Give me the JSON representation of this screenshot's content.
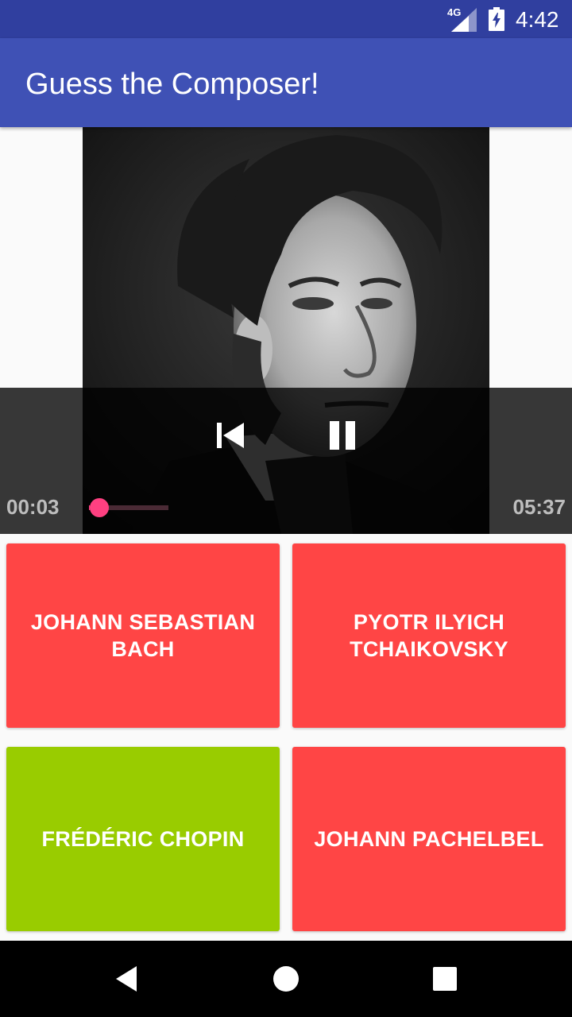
{
  "status_bar": {
    "network": "4G",
    "time": "4:42"
  },
  "app_bar": {
    "title": "Guess the Composer!"
  },
  "portrait": {
    "icon": "composer-portrait-image"
  },
  "media_controller": {
    "current_time": "00:03",
    "total_time": "05:37",
    "progress_fraction": 0.01,
    "accent": "#ff4081",
    "prev_icon": "skip-previous-icon",
    "pause_icon": "pause-icon"
  },
  "answers": [
    {
      "label": "JOHANN SEBASTIAN BACH",
      "state": "wrong",
      "color": "#ff4545"
    },
    {
      "label": "PYOTR ILYICH TCHAIKOVSKY",
      "state": "wrong",
      "color": "#ff4545"
    },
    {
      "label": "FRÉDÉRIC CHOPIN",
      "state": "correct",
      "color": "#99cc00"
    },
    {
      "label": "JOHANN PACHELBEL",
      "state": "wrong",
      "color": "#ff4545"
    }
  ],
  "colors": {
    "status_bar": "#303f9f",
    "app_bar": "#3f51b5",
    "wrong": "#ff4545",
    "correct": "#99cc00"
  },
  "nav_bar": {
    "back_icon": "back-triangle-icon",
    "home_icon": "home-circle-icon",
    "recent_icon": "recents-square-icon"
  }
}
